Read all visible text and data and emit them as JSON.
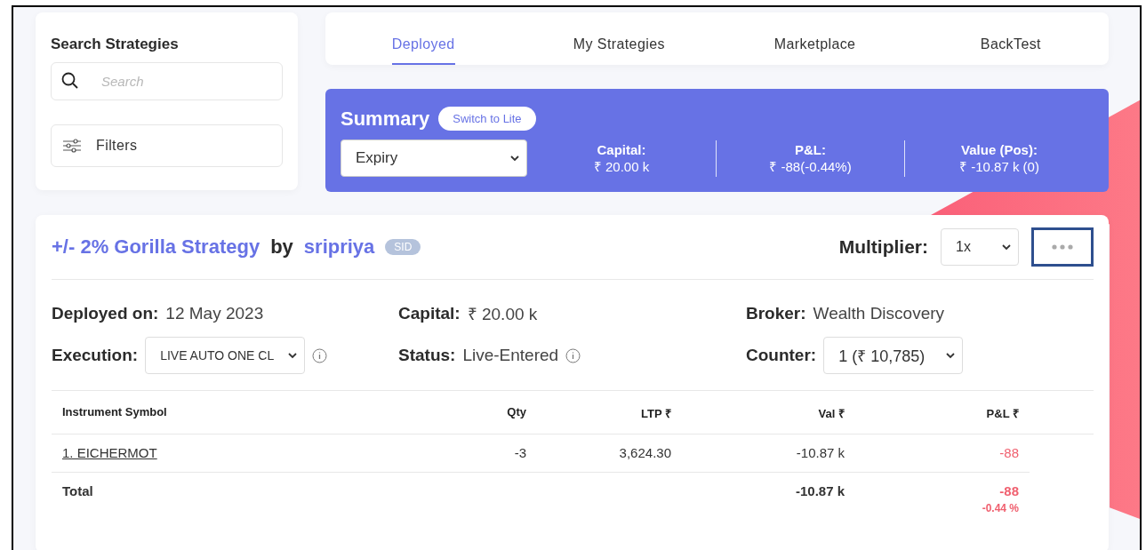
{
  "sidebar": {
    "title": "Search Strategies",
    "search": {
      "placeholder": "Search"
    },
    "filters": "Filters"
  },
  "tabs": [
    {
      "label": "Deployed",
      "selected": true
    },
    {
      "label": "My Strategies",
      "selected": false
    },
    {
      "label": "Marketplace",
      "selected": false
    },
    {
      "label": "BackTest",
      "selected": false
    }
  ],
  "summary": {
    "title": "Summary",
    "switch_button": "Switch to Lite",
    "expiry_select": "Expiry",
    "stats": [
      {
        "label": "Capital:",
        "value": "₹ 20.00 k"
      },
      {
        "label": "P&L:",
        "value": "₹ -88(-0.44%)"
      },
      {
        "label": "Value (Pos):",
        "value": "₹ -10.87 k (0)"
      }
    ]
  },
  "strategy": {
    "name": "+/- 2% Gorilla Strategy",
    "by": "by",
    "author": "sripriya",
    "badge": "SID",
    "multiplier_label": "Multiplier:",
    "multiplier": "1x",
    "more_highlighted": true,
    "fields": [
      {
        "kind": "text",
        "label": "Deployed on:",
        "value": "12 May 2023",
        "info": false
      },
      {
        "kind": "text",
        "label": "Capital:",
        "value": "₹ 20.00 k",
        "info": false
      },
      {
        "kind": "text",
        "label": "Broker:",
        "value": "Wealth Discovery",
        "info": false
      },
      {
        "kind": "select",
        "label": "Execution:",
        "value": "LIVE AUTO ONE CL",
        "info": true
      },
      {
        "kind": "text",
        "label": "Status:",
        "value": "Live-Entered",
        "info": true
      },
      {
        "kind": "select",
        "label": "Counter:",
        "value": "1 (₹ 10,785)",
        "info": false
      }
    ],
    "table": {
      "columns": [
        "Instrument Symbol",
        "Qty",
        "LTP ₹",
        "Val ₹",
        "P&L ₹"
      ],
      "rows": [
        {
          "symbol": "1. EICHERMOT",
          "qty": "-3",
          "ltp": "3,624.30",
          "val": "-10.87 k",
          "pnl": "-88",
          "pnl_negative": true
        }
      ],
      "total": {
        "label": "Total",
        "val": "-10.87 k",
        "pnl": "-88",
        "pnl_pct": "-0.44 %",
        "pnl_negative": true
      }
    }
  }
}
